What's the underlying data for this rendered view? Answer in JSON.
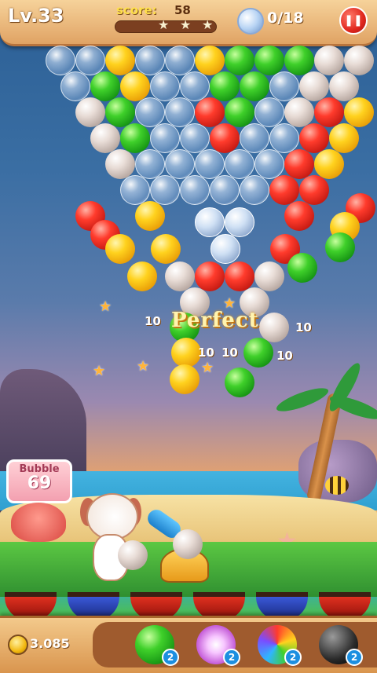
{
  "hud": {
    "level": "Lv.33",
    "score_label": "score:",
    "score_value": "58",
    "pets_rescued": "0/18",
    "pause_icon": "pause-icon"
  },
  "bonus_sign": {
    "title": "Bubble",
    "count": "69"
  },
  "floating_text": {
    "perfect": "Perfect",
    "points": "10"
  },
  "coins": "3.085",
  "powerups": [
    {
      "name": "aim-line",
      "count": "2"
    },
    {
      "name": "lightning-bubble",
      "count": "2"
    },
    {
      "name": "rainbow-bubble",
      "count": "2"
    },
    {
      "name": "bomb-bubble",
      "count": "2"
    }
  ],
  "colors": {
    "red": "#ff3b2c",
    "yellow": "#ffd21e",
    "green": "#3fd02a",
    "white": "#e8dcd6",
    "glass": "#dcebff"
  },
  "ammo": {
    "current": "white",
    "next": "white"
  }
}
